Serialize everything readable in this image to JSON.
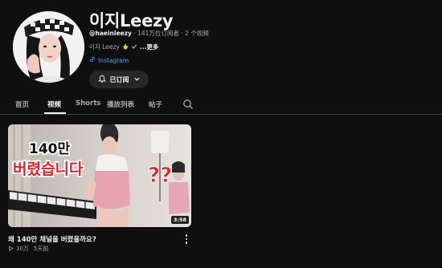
{
  "channel": {
    "title": "이지Leezy",
    "handle": "@haeinleezy",
    "subscribers": "141万位订阅者",
    "videos_count": "2 个视频",
    "description": "이지 Leezy",
    "more_label": "...更多",
    "link_label": "Instagram",
    "subscribe_label": "已订阅"
  },
  "tabs": [
    {
      "label": "首页",
      "active": false
    },
    {
      "label": "视频",
      "active": true
    },
    {
      "label": "Shorts",
      "active": false
    },
    {
      "label": "播放列表",
      "active": false
    },
    {
      "label": "帖子",
      "active": false
    }
  ],
  "video": {
    "thumb_text_line1": "140만",
    "thumb_text_line2": "버렸습니다",
    "thumb_qmarks": "??",
    "duration": "3:58",
    "title": "왜 140만 채널을 버렸을까요?",
    "views": "10万",
    "age": "5天前"
  },
  "icons": [
    "verified-check-icon",
    "hand-emoji-icon",
    "link-icon",
    "bell-icon",
    "chevron-down-icon",
    "search-icon",
    "more-vert-icon",
    "play-outline-icon"
  ]
}
